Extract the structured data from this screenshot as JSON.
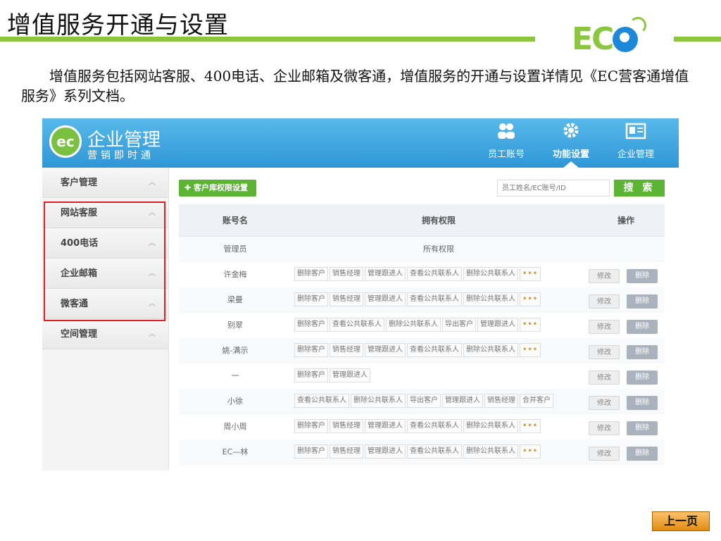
{
  "slide": {
    "title": "增值服务开通与设置",
    "logo_text": "EC",
    "description": "增值服务包括网站客服、400电话、企业邮箱及微客通，增值服务的开通与设置详情见《EC营客通增值服务》系列文档。",
    "prev_label": "上一页"
  },
  "app": {
    "logo_text": "ec",
    "name": "企业管理",
    "slogan": "营销即时通",
    "nav": [
      {
        "label": "员工账号",
        "icon": "staff-icon"
      },
      {
        "label": "功能设置",
        "icon": "gear-icon",
        "active": true
      },
      {
        "label": "企业管理",
        "icon": "enterprise-icon"
      }
    ],
    "sidebar": [
      {
        "label": "客户管理"
      },
      {
        "label": "网站客服"
      },
      {
        "label": "400电话"
      },
      {
        "label": "企业邮箱"
      },
      {
        "label": "微客通"
      },
      {
        "label": "空间管理"
      }
    ],
    "add_button": "客户库权限设置",
    "search_placeholder": "员工姓名/EC账号/ID",
    "search_button": "搜 索",
    "table": {
      "headers": {
        "name": "账号名",
        "perms": "拥有权限",
        "op": "操作"
      },
      "edit_label": "修改",
      "delete_label": "删除",
      "all_perm_label": "所有权限",
      "rows": [
        {
          "name": "管理员",
          "tags": []
        },
        {
          "name": "许金梅",
          "tags": [
            "删除客户",
            "销售经理",
            "管理跟进人",
            "查看公共联系人",
            "删除公共联系人",
            "•••"
          ]
        },
        {
          "name": "梁曼",
          "tags": [
            "删除客户",
            "销售经理",
            "管理跟进人",
            "查看公共联系人",
            "删除公共联系人",
            "•••"
          ]
        },
        {
          "name": "别翠",
          "tags": [
            "删除客户",
            "查看公共联系人",
            "删除公共联系人",
            "导出客户",
            "管理跟进人",
            "•••"
          ]
        },
        {
          "name": "姚-满示",
          "tags": [
            "删除客户",
            "销售经理",
            "管理跟进人",
            "查看公共联系人",
            "删除公共联系人",
            "•••"
          ]
        },
        {
          "name": "一",
          "tags": [
            "删除客户",
            "管理跟进人"
          ]
        },
        {
          "name": "小徐",
          "tags": [
            "查看公共联系人",
            "删除公共联系人",
            "导出客户",
            "管理跟进人",
            "销售经理",
            "合并客户"
          ]
        },
        {
          "name": "周小周",
          "tags": [
            "删除客户",
            "销售经理",
            "管理跟进人",
            "查看公共联系人",
            "删除公共联系人",
            "•••"
          ]
        },
        {
          "name": "EC—林",
          "tags": [
            "删除客户",
            "销售经理",
            "管理跟进人",
            "查看公共联系人",
            "删除公共联系人",
            "•••"
          ]
        }
      ]
    }
  }
}
